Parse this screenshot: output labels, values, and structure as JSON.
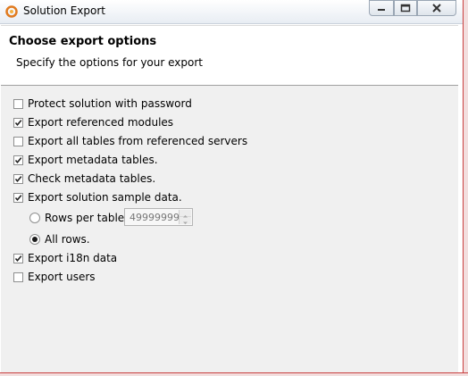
{
  "window": {
    "title": "Solution Export"
  },
  "header": {
    "title": "Choose export options",
    "description": "Specify the options for your export"
  },
  "options": [
    {
      "label": "Protect solution with password",
      "checked": false
    },
    {
      "label": "Export referenced modules",
      "checked": true
    },
    {
      "label": "Export all tables from referenced servers",
      "checked": false
    },
    {
      "label": "Export metadata tables.",
      "checked": true
    },
    {
      "label": "Check metadata tables.",
      "checked": true
    },
    {
      "label": "Export solution sample data.",
      "checked": true
    }
  ],
  "sample_data": {
    "rows_per_table_label": "Rows per table:",
    "rows_per_table_value": "49999999",
    "rows_per_table_selected": false,
    "all_rows_label": "All rows.",
    "all_rows_selected": true
  },
  "options_after": [
    {
      "label": "Export i18n data",
      "checked": true
    },
    {
      "label": "Export users",
      "checked": false
    }
  ],
  "colors": {
    "content_bg": "#f0f0f0",
    "header_bg": "#ffffff",
    "frame_accent": "#c94040"
  }
}
